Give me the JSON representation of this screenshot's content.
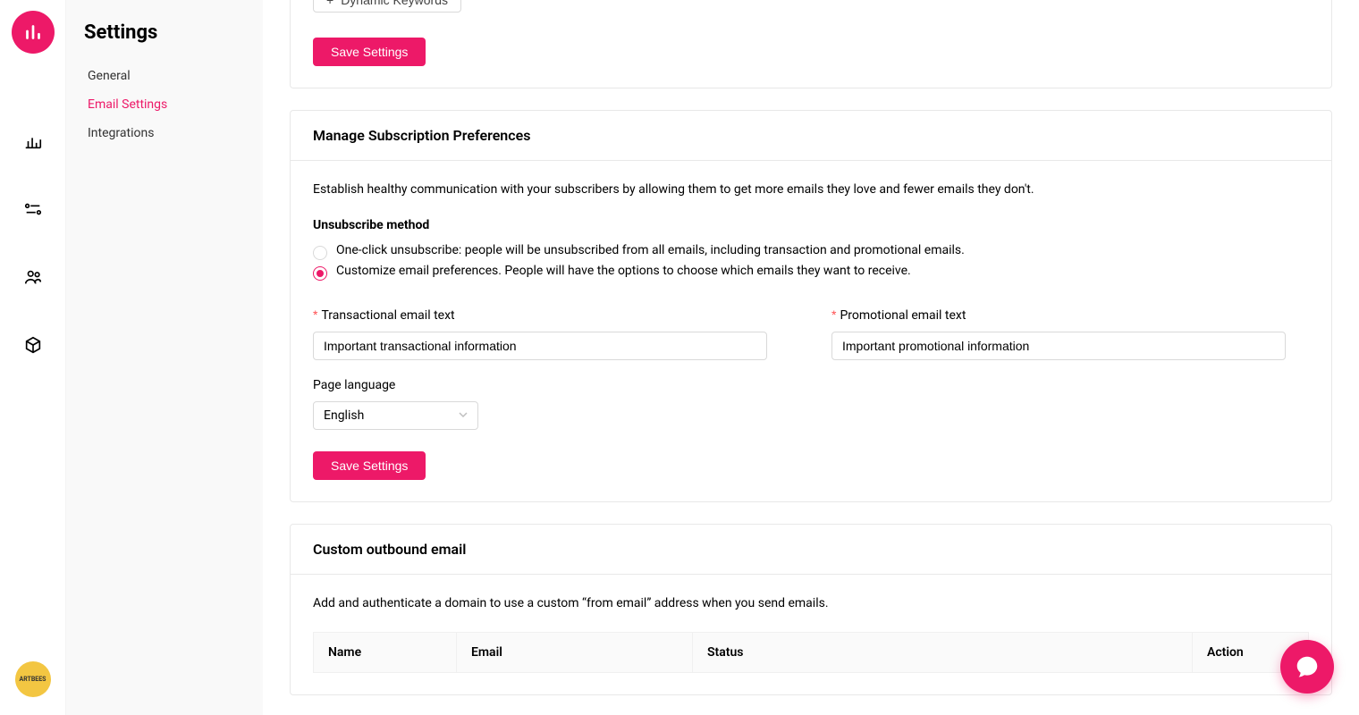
{
  "rail": {
    "org_badge_text": "ARTBEES"
  },
  "sidebar": {
    "title": "Settings",
    "items": [
      {
        "label": "General"
      },
      {
        "label": "Email Settings"
      },
      {
        "label": "Integrations"
      }
    ]
  },
  "partial_card": {
    "dynamic_keywords_label": "Dynamic Keywords",
    "save_label": "Save Settings"
  },
  "subscription": {
    "title": "Manage Subscription Preferences",
    "description": "Establish healthy communication with your subscribers by allowing them to get more emails they love and fewer emails they don't.",
    "method_label": "Unsubscribe method",
    "option_one_click": "One-click unsubscribe: people will be unsubscribed from all emails, including transaction and promotional emails.",
    "option_customize": "Customize email preferences. People will have the options to choose which emails they want to receive.",
    "transactional_label": "Transactional email text",
    "transactional_value": "Important transactional information",
    "promotional_label": "Promotional email text",
    "promotional_value": "Important promotional information",
    "page_language_label": "Page language",
    "page_language_value": "English",
    "save_label": "Save Settings"
  },
  "outbound": {
    "title": "Custom outbound email",
    "description": "Add and authenticate a domain to use a custom “from email” address when you send emails.",
    "columns": [
      "Name",
      "Email",
      "Status",
      "Action"
    ]
  }
}
